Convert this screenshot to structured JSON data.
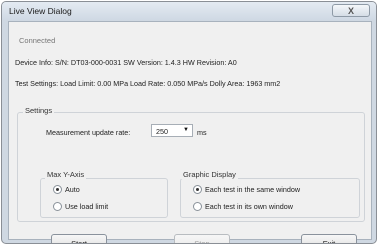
{
  "window": {
    "title": "Live View Dialog",
    "close_glyph": "X"
  },
  "status": "Connected",
  "device_info": "Device Info: S/N: DT03-000-0031  SW Version: 1.4.3  HW Revision: A0",
  "test_settings": "Test Settings: Load Limit: 0.00 MPa  Load Rate: 0.050 MPa/s  Dolly Area: 1963 mm2",
  "settings": {
    "label": "Settings",
    "update_rate_label": "Measurement update rate:",
    "update_rate_value": "250",
    "update_rate_unit": "ms"
  },
  "max_y_axis": {
    "label": "Max Y-Axis",
    "options": [
      "Auto",
      "Use load limit"
    ],
    "selected": "Auto"
  },
  "graphic_display": {
    "label": "Graphic Display",
    "options": [
      "Each test in the same window",
      "Each test in its own window"
    ],
    "selected": "Each test in the same window"
  },
  "buttons": {
    "start": "Start",
    "stop": "Stop",
    "exit": "Exit"
  },
  "colors": {
    "titlebar": "#d6dee8",
    "client_bg": "#f0f0f0",
    "disabled_text": "#a0a0a0"
  },
  "icons": {
    "close": "close-icon",
    "dropdown": "chevron-down-icon"
  }
}
